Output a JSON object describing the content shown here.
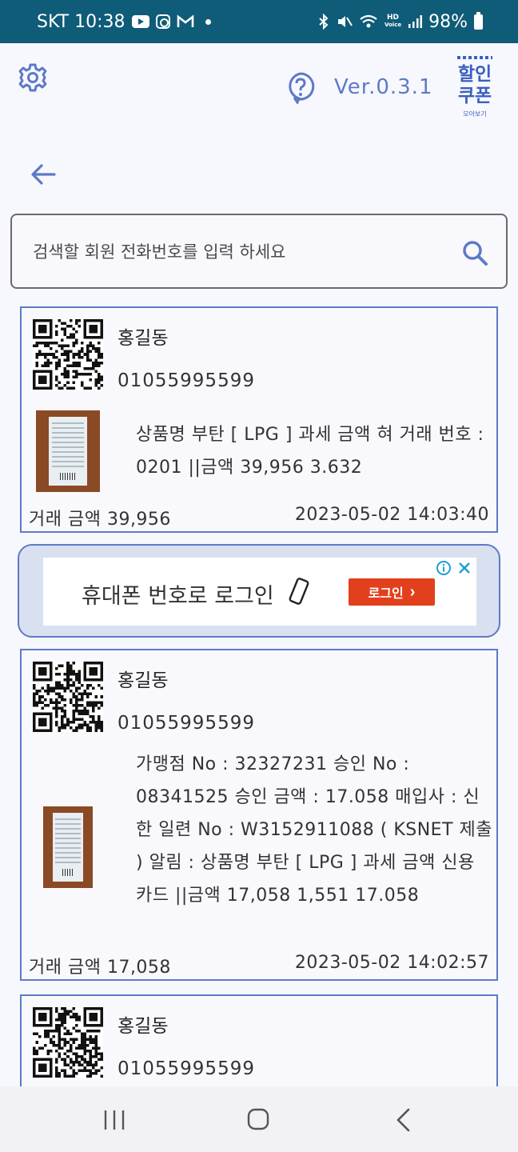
{
  "status_bar": {
    "carrier_time": "SKT 10:38",
    "hd_label": "HD",
    "voice_label": "Voice",
    "battery": "98%"
  },
  "header": {
    "version": "Ver.0.3.1",
    "logo_line1": "할인",
    "logo_line2": "쿠폰",
    "logo_sub": "모아보기"
  },
  "search": {
    "placeholder": "검색할 회원 전화번호를 입력 하세요"
  },
  "cards": [
    {
      "name": "홍길동",
      "phone": "01055995599",
      "description": "상품명 부탄 [ LPG ] 과세 금액 혀 거래 번호 : 0201 ||금액 39,956 3.632",
      "amount": "거래 금액 39,956",
      "datetime": "2023-05-02 14:03:40"
    },
    {
      "name": "홍길동",
      "phone": "01055995599",
      "description": "가맹점 No : 32327231 승인 No : 08341525 승인 금액 : 17.058 매입사 : 신한 일련 No : W3152911088 ( KSNET 제출 ) 알림 : 상품명 부탄 [ LPG ] 과세 금액 신용 카드 ||금액 17,058 1,551 17.058",
      "amount": "거래 금액 17,058",
      "datetime": "2023-05-02 14:02:57"
    },
    {
      "name": "홍길동",
      "phone": "01055995599"
    }
  ],
  "ad": {
    "text": "휴대폰 번호로 로그인",
    "button_label": "로그인",
    "button_arrow": "›"
  },
  "colors": {
    "accent": "#5e79c8",
    "status_bar": "#0f5c78",
    "ad_button": "#e2401c"
  }
}
